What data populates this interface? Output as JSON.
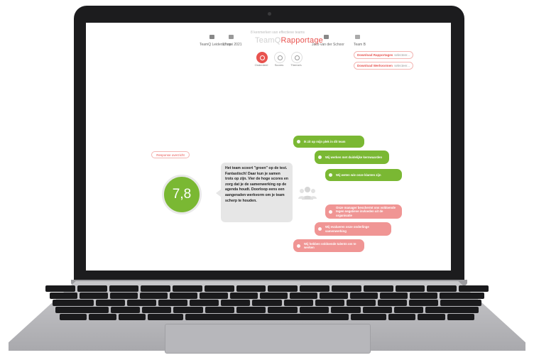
{
  "header": {
    "team_label": "TeamQ Leiderschap",
    "date": "17 mei 2021",
    "brand_sub": "8 kenmerken van effectieve teams",
    "brand_prefix": "TeamQ",
    "brand_accent": "Rapportage",
    "user": "Jaco van der Schoor",
    "team": "Team B"
  },
  "tabs": [
    {
      "label": "Onderdeel",
      "icon": "target-icon",
      "active": true
    },
    {
      "label": "Scores",
      "icon": "bar-chart-icon",
      "active": false
    },
    {
      "label": "Thema's",
      "icon": "clipboard-icon",
      "active": false
    }
  ],
  "downloads": [
    {
      "title": "Download Rapportages",
      "select": "selecteer..."
    },
    {
      "title": "Download Werkvormen",
      "select": "selecteer..."
    }
  ],
  "response_button": "Response overzicht",
  "score": {
    "value": "7,8",
    "color": "#7ab833"
  },
  "description": "Het team scoort \"groen\" op de test. Fantastisch! Daar kun je samen trots op zijn. Vier de hoge scores en zorg dat je de samenwerking op de agenda houdt. Doorloop eens een aangeraden werkvorm om je team scherp te houden.",
  "bubbles_positive": [
    {
      "text": "Ik zit op mijn plek in dit team",
      "icon": "heart-icon"
    },
    {
      "text": "Wij werken met duidelijke kernwaarden",
      "icon": "heart-icon"
    },
    {
      "text": "Wij weten wie onze klanten zijn",
      "icon": "person-icon"
    }
  ],
  "bubbles_negative": [
    {
      "text": "Onze manager beschermt ons voldoende tegen negatieve invloeden uit de organisatie",
      "icon": "hammer-icon"
    },
    {
      "text": "Wij evalueren onze onderlinge samenwerking",
      "icon": "refresh-icon"
    },
    {
      "text": "Wij hebben voldoende talentn om te werken",
      "icon": "heart-icon"
    }
  ],
  "colors": {
    "accent": "#e8534f",
    "positive": "#7ab833",
    "negative": "#f09594"
  }
}
